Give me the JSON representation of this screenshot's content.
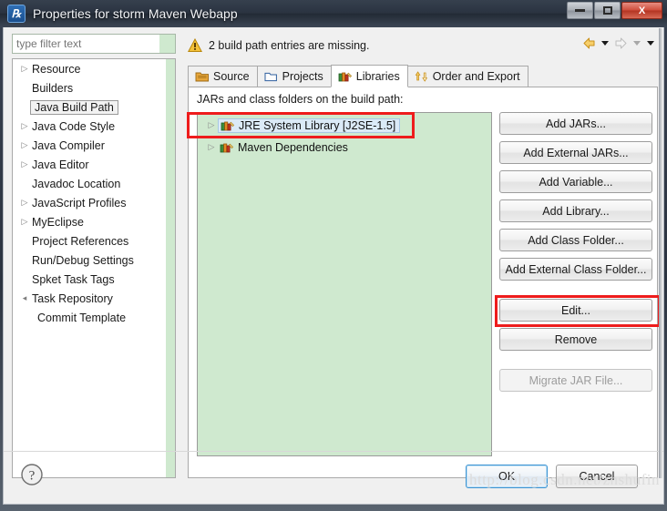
{
  "window": {
    "title": "Properties for storm Maven Webapp",
    "icon": "eclipse-icon",
    "minimize_label": "Minimize",
    "maximize_label": "Maximize",
    "close_label": "X"
  },
  "sidebar": {
    "filter": {
      "value": "",
      "placeholder": "type filter text"
    },
    "items": [
      {
        "label": "Resource",
        "expander": "collapsed",
        "indent": 0,
        "selected": false
      },
      {
        "label": "Builders",
        "expander": "none",
        "indent": 0,
        "selected": false
      },
      {
        "label": "Java Build Path",
        "expander": "none",
        "indent": 0,
        "selected": true
      },
      {
        "label": "Java Code Style",
        "expander": "collapsed",
        "indent": 0,
        "selected": false
      },
      {
        "label": "Java Compiler",
        "expander": "collapsed",
        "indent": 0,
        "selected": false
      },
      {
        "label": "Java Editor",
        "expander": "collapsed",
        "indent": 0,
        "selected": false
      },
      {
        "label": "Javadoc Location",
        "expander": "none",
        "indent": 0,
        "selected": false
      },
      {
        "label": "JavaScript Profiles",
        "expander": "collapsed",
        "indent": 0,
        "selected": false
      },
      {
        "label": "MyEclipse",
        "expander": "collapsed",
        "indent": 0,
        "selected": false
      },
      {
        "label": "Project References",
        "expander": "none",
        "indent": 0,
        "selected": false
      },
      {
        "label": "Run/Debug Settings",
        "expander": "none",
        "indent": 0,
        "selected": false
      },
      {
        "label": "Spket Task Tags",
        "expander": "none",
        "indent": 0,
        "selected": false
      },
      {
        "label": "Task Repository",
        "expander": "expanded",
        "indent": 0,
        "selected": false
      },
      {
        "label": "Commit Template",
        "expander": "none",
        "indent": 1,
        "selected": false
      }
    ]
  },
  "message": {
    "text": "2 build path entries are missing.",
    "icon": "warning-icon",
    "back_label": "Back",
    "forward_label": "Forward"
  },
  "tabs": [
    {
      "label": "Source",
      "icon": "source-folder-icon",
      "active": false
    },
    {
      "label": "Projects",
      "icon": "project-folder-icon",
      "active": false
    },
    {
      "label": "Libraries",
      "icon": "books-icon",
      "active": true
    },
    {
      "label": "Order and Export",
      "icon": "order-arrows-icon",
      "active": false
    }
  ],
  "libraries_tab": {
    "list_label": "JARs and class folders on the build path:",
    "entries": [
      {
        "label": "JRE System Library [J2SE-1.5]",
        "icon": "books-icon",
        "selected": true,
        "expander": "collapsed"
      },
      {
        "label": "Maven Dependencies",
        "icon": "books-icon",
        "selected": false,
        "expander": "collapsed"
      }
    ],
    "buttons": [
      {
        "label": "Add JARs...",
        "disabled": false,
        "highlighted": false
      },
      {
        "label": "Add External JARs...",
        "disabled": false,
        "highlighted": false
      },
      {
        "label": "Add Variable...",
        "disabled": false,
        "highlighted": false
      },
      {
        "label": "Add Library...",
        "disabled": false,
        "highlighted": false
      },
      {
        "label": "Add Class Folder...",
        "disabled": false,
        "highlighted": false
      },
      {
        "label": "Add External Class Folder...",
        "disabled": false,
        "highlighted": false
      },
      {
        "label": "Edit...",
        "disabled": false,
        "highlighted": true
      },
      {
        "label": "Remove",
        "disabled": false,
        "highlighted": false
      },
      {
        "label": "Migrate JAR File...",
        "disabled": true,
        "highlighted": false
      }
    ]
  },
  "footer": {
    "help_label": "?",
    "ok_label": "OK",
    "cancel_label": "Cancel",
    "watermark": "http://blog.csdn.net/zhshufin"
  },
  "colors": {
    "panel_green": "#cfe9cf",
    "annotation_red": "#ee1c1c",
    "selection_blue": "#dbeaf7",
    "dialog_gray": "#f0f0f0"
  }
}
